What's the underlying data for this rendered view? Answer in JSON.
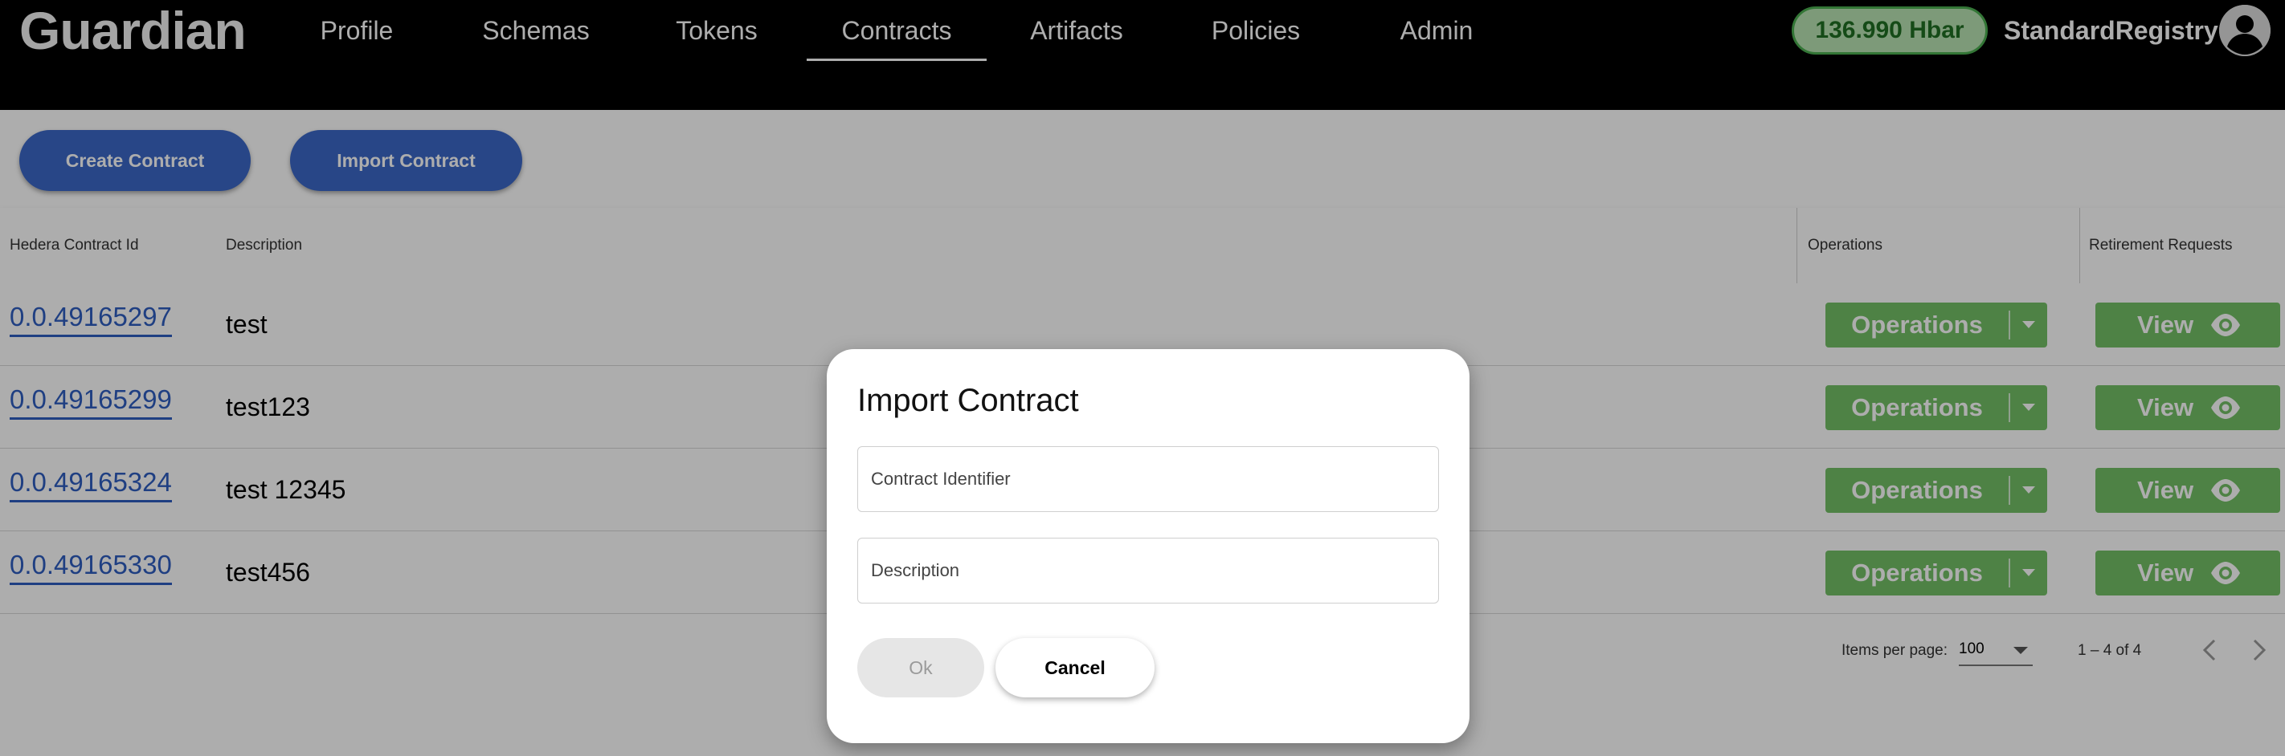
{
  "header": {
    "logo": "Guardian",
    "nav": [
      {
        "label": "Profile",
        "active": false
      },
      {
        "label": "Schemas",
        "active": false
      },
      {
        "label": "Tokens",
        "active": false
      },
      {
        "label": "Contracts",
        "active": true
      },
      {
        "label": "Artifacts",
        "active": false
      },
      {
        "label": "Policies",
        "active": false
      },
      {
        "label": "Admin",
        "active": false
      }
    ],
    "balance": "136.990 Hbar",
    "username": "StandardRegistry",
    "avatar_icon": "account-circle-icon"
  },
  "toolbar": {
    "create_label": "Create Contract",
    "import_label": "Import Contract"
  },
  "table": {
    "columns": [
      "Hedera Contract Id",
      "Description",
      "Operations",
      "Retirement Requests"
    ],
    "rows": [
      {
        "id": "0.0.49165297",
        "description": "test",
        "operations": "Operations",
        "view": "View"
      },
      {
        "id": "0.0.49165299",
        "description": "test123",
        "operations": "Operations",
        "view": "View"
      },
      {
        "id": "0.0.49165324",
        "description": "test 12345",
        "operations": "Operations",
        "view": "View"
      },
      {
        "id": "0.0.49165330",
        "description": "test456",
        "operations": "Operations",
        "view": "View"
      }
    ]
  },
  "paginator": {
    "items_label": "Items per page:",
    "page_size": "100",
    "range": "1 – 4 of 4"
  },
  "dialog": {
    "title": "Import Contract",
    "contract_placeholder": "Contract Identifier",
    "description_placeholder": "Description",
    "contract_value": "",
    "description_value": "",
    "ok_label": "Ok",
    "cancel_label": "Cancel"
  },
  "colors": {
    "primary": "#3c68c8",
    "success": "#73c066",
    "link": "#2f5dc0",
    "header_bg": "#000000"
  }
}
